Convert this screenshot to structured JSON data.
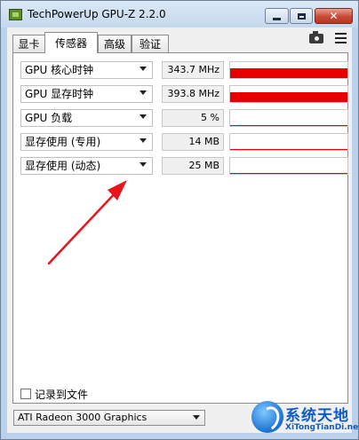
{
  "window": {
    "title": "TechPowerUp GPU-Z 2.2.0",
    "close_glyph": "✕"
  },
  "tabs": [
    {
      "label": "显卡",
      "active": false
    },
    {
      "label": "传感器",
      "active": true
    },
    {
      "label": "高级",
      "active": false
    },
    {
      "label": "验证",
      "active": false
    }
  ],
  "toolbar": {
    "camera_icon": "camera-icon",
    "menu_icon": "hamburger-menu-icon"
  },
  "sensors": [
    {
      "label": "GPU 核心时钟",
      "value": "343.7 MHz",
      "graph_level": 0.6
    },
    {
      "label": "GPU 显存时钟",
      "value": "393.8 MHz",
      "graph_level": 0.6
    },
    {
      "label": "GPU 负载",
      "value": "5 %",
      "graph_level": 0.05
    },
    {
      "label": "显存使用 (专用)",
      "value": "14 MB",
      "graph_level": 0.05
    },
    {
      "label": "显存使用 (动态)",
      "value": "25 MB",
      "graph_level": 0.05
    }
  ],
  "log": {
    "label": "记录到文件",
    "checked": false
  },
  "gpu_select": {
    "value": "ATI Radeon 3000 Graphics"
  },
  "annotation": {
    "type": "red-arrow",
    "color": "#e8141b"
  },
  "colors": {
    "graph": "#e60000",
    "watermark": "#0f5bc4"
  },
  "watermark": {
    "title": "系统天地",
    "subtitle": "XiTongTianDi.net"
  }
}
